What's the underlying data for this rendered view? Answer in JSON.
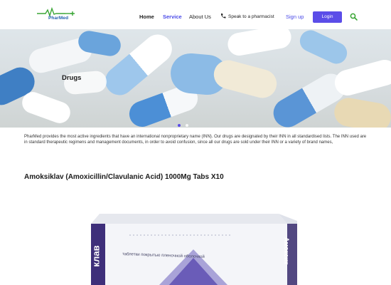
{
  "header": {
    "logo_text": "PharMed",
    "nav": {
      "home": "Home",
      "service": "Service",
      "about": "About Us",
      "speak": "Speak to a pharmacist",
      "signup": "Sign up",
      "login": "Login"
    }
  },
  "hero": {
    "title": "Drugs",
    "slides": 2,
    "active_slide": 1
  },
  "intro": "PharMed provides the most active ingredients that have an international nonproprietary name (INN). Our drugs are designated by their INN in all standardised lists. The INN used are in standard therapeutic regimens and management documents, in order to avoid confusion, since all our drugs are sold under their INN or a variety of brand names,",
  "product": {
    "title": "Amoksiklav (Amoxicillin/Clavulanic Acid) 1000Mg Tabs X10",
    "package_side_text": "таблетки покрытые пленочной оболочкой",
    "package_brand_left": "клав",
    "package_brand_right": "Амоксик"
  },
  "colors": {
    "accent": "#5b4de8",
    "logo_green": "#3aa635",
    "logo_blue": "#1f5fae"
  }
}
